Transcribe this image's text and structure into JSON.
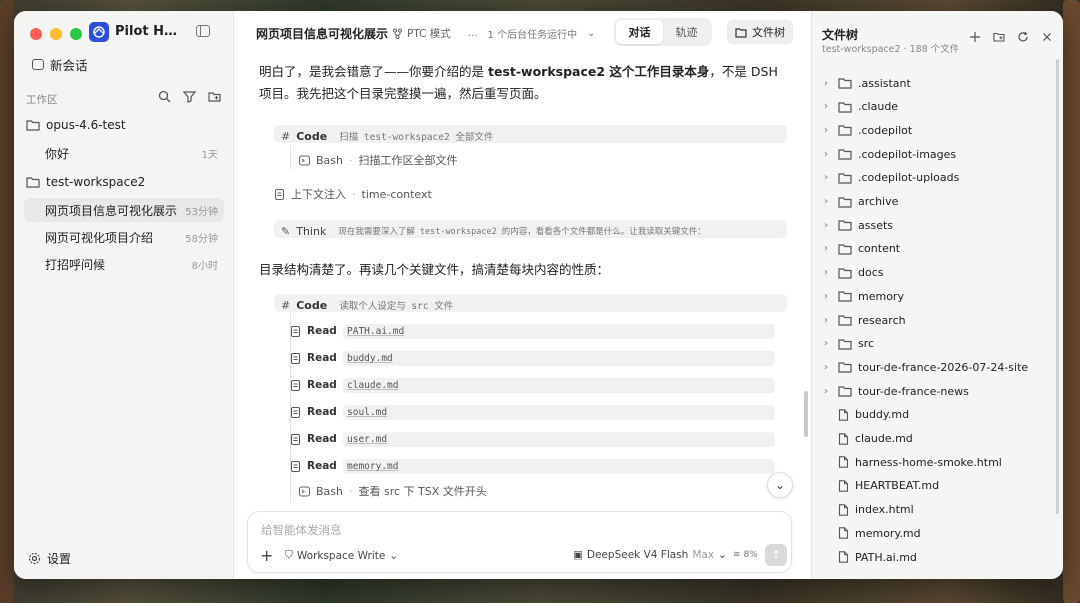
{
  "app": {
    "title": "Pilot Harn..."
  },
  "sidebar": {
    "new_chat": "新会话",
    "workspace_label": "工作区",
    "folders": [
      {
        "name": "opus-4.6-test",
        "chats": [
          {
            "title": "你好",
            "time": "1天"
          }
        ]
      },
      {
        "name": "test-workspace2",
        "chats": [
          {
            "title": "网页项目信息可视化展示",
            "time": "53分钟",
            "active": true
          },
          {
            "title": "网页可视化项目介绍",
            "time": "58分钟"
          },
          {
            "title": "打招呼问候",
            "time": "8小时"
          }
        ]
      }
    ],
    "settings": "设置"
  },
  "header": {
    "title": "网页项目信息可视化展示",
    "mode": "PTC 模式",
    "ellipsis": "...",
    "bg_tasks": "1 个后台任务运行中",
    "tabs": [
      "对话",
      "轨迹"
    ],
    "active_tab": "对话",
    "filetree_button": "文件树"
  },
  "chat": {
    "intro_pre": "明白了，是我会错意了——你要介绍的是 ",
    "intro_bold": "test-workspace2 这个工作目录本身",
    "intro_post": "，不是 DSH 项目。我先把这个目录完整摸一遍，然后重写页面。",
    "code1": {
      "label": "Code",
      "note": "扫描 test-workspace2 全部文件"
    },
    "bash1": {
      "label": "Bash",
      "sep": "·",
      "text": "扫描工作区全部文件"
    },
    "ctx": {
      "label": "上下文注入",
      "sep": "·",
      "text": "time-context"
    },
    "think": {
      "label": "Think",
      "note": "现在我需要深入了解 test-workspace2 的内容，看看各个文件都是什么。让我读取关键文件："
    },
    "mid_text": "目录结构清楚了。再读几个关键文件，搞清楚每块内容的性质：",
    "code2": {
      "label": "Code",
      "note": "读取个人设定与 src 文件"
    },
    "reads": [
      {
        "label": "Read",
        "file": "PATH.ai.md"
      },
      {
        "label": "Read",
        "file": "buddy.md"
      },
      {
        "label": "Read",
        "file": "claude.md"
      },
      {
        "label": "Read",
        "file": "soul.md"
      },
      {
        "label": "Read",
        "file": "user.md"
      },
      {
        "label": "Read",
        "file": "memory.md"
      }
    ],
    "bash2": {
      "label": "Bash",
      "sep": "·",
      "text": "查看 src 下 TSX 文件开头"
    }
  },
  "composer": {
    "placeholder": "给智能体发消息",
    "mode": "Workspace Write",
    "model": "DeepSeek V4 Flash",
    "model_tier": "Max",
    "context_pct": "8%"
  },
  "filetree": {
    "title": "文件树",
    "subtitle": "test-workspace2 · 188 个文件",
    "folders": [
      ".assistant",
      ".claude",
      ".codepilot",
      ".codepilot-images",
      ".codepilot-uploads",
      "archive",
      "assets",
      "content",
      "docs",
      "memory",
      "research",
      "src",
      "tour-de-france-2026-07-24-site",
      "tour-de-france-news"
    ],
    "files": [
      "buddy.md",
      "claude.md",
      "harness-home-smoke.html",
      "HEARTBEAT.md",
      "index.html",
      "memory.md",
      "PATH.ai.md"
    ]
  }
}
